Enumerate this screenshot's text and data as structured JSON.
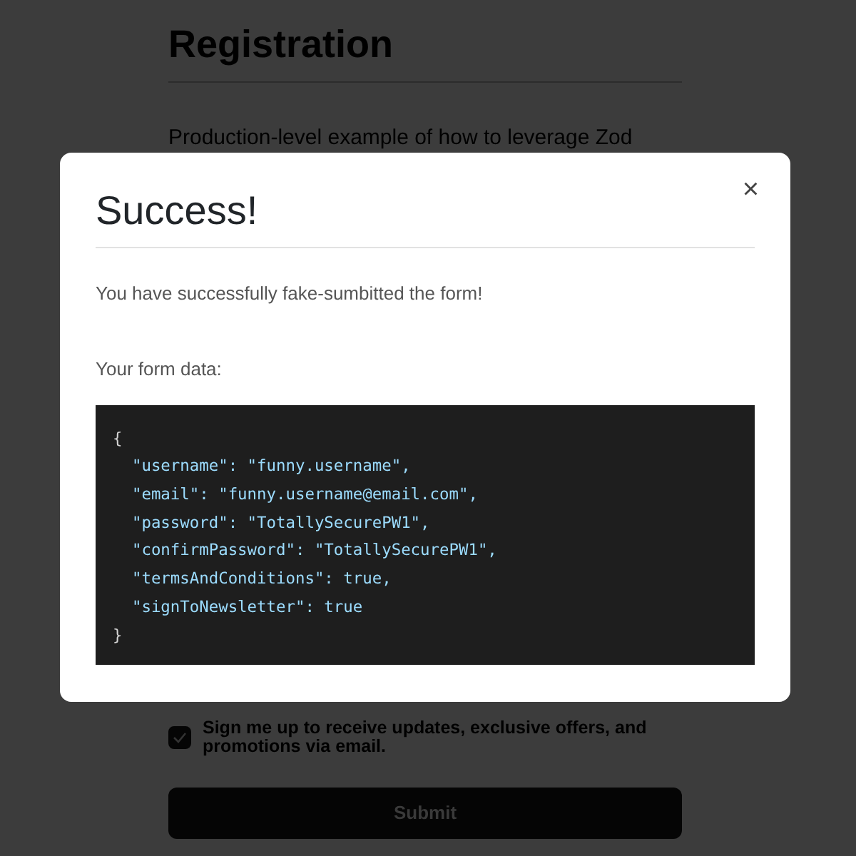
{
  "page": {
    "title": "Registration",
    "intro": "Production-level example of how to leverage Zod",
    "newsletter": {
      "label": "Sign me up to receive updates, exclusive offers, and promotions via email.",
      "checked": true
    },
    "submit": "Submit"
  },
  "modal": {
    "title": "Success!",
    "close": "×",
    "message": "You have successfully fake-sumbitted the form!",
    "data_label": "Your form data:",
    "code_lines": [
      "{",
      "  \"username\": \"funny.username\",",
      "  \"email\": \"funny.username@email.com\",",
      "  \"password\": \"TotallySecurePW1\",",
      "  \"confirmPassword\": \"TotallySecurePW1\",",
      "  \"termsAndConditions\": true,",
      "  \"signToNewsletter\": true",
      "}"
    ]
  }
}
